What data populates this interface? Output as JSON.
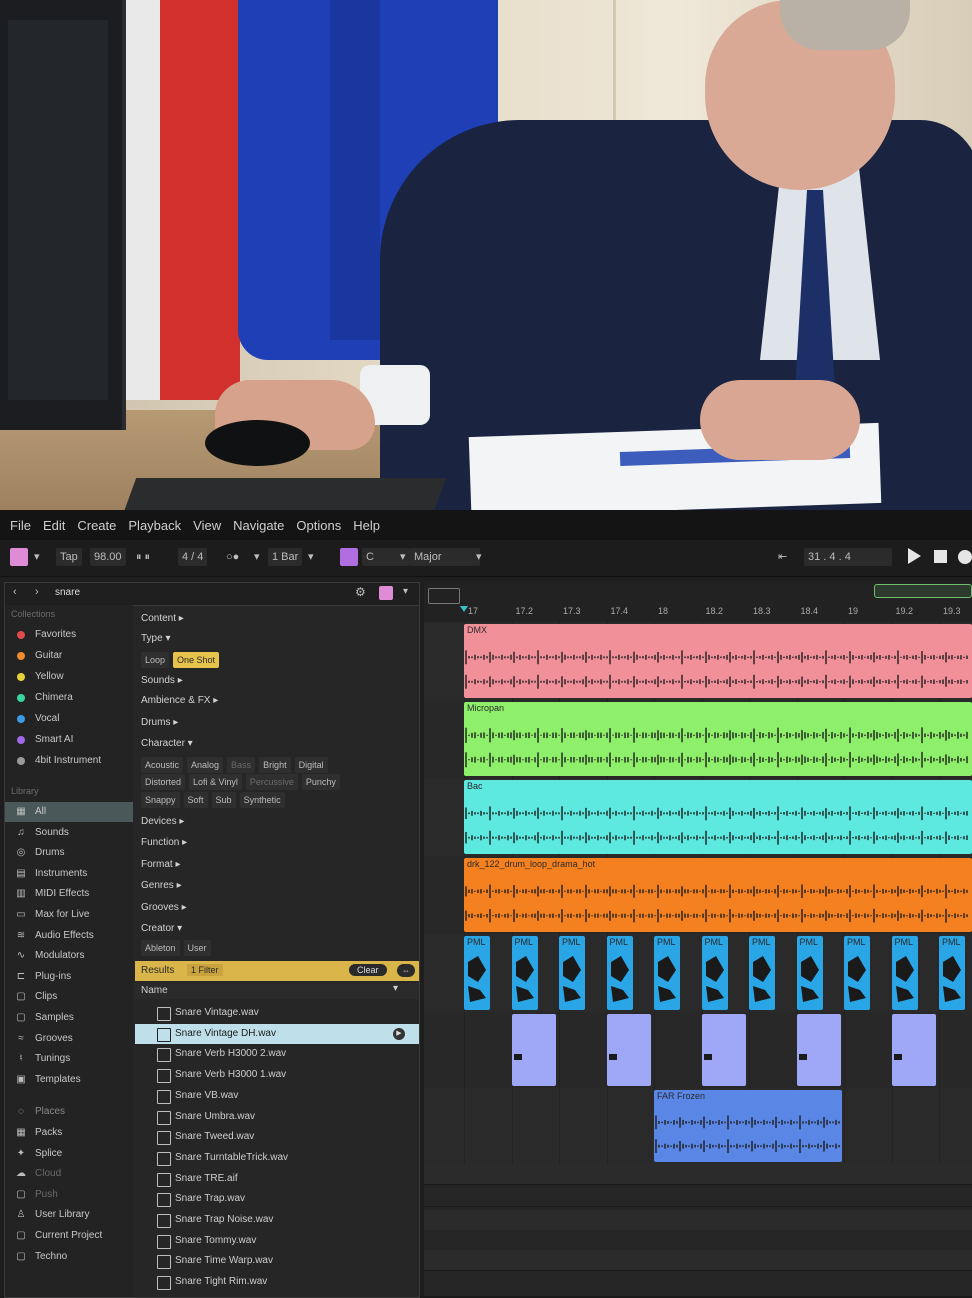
{
  "menu": [
    "File",
    "Edit",
    "Create",
    "Playback",
    "View",
    "Navigate",
    "Options",
    "Help"
  ],
  "transport": {
    "tap": "Tap",
    "tempo": "98.00",
    "time_sig": "4 / 4",
    "quant": "1 Bar",
    "key": "C",
    "scale": "Major",
    "position": "31 .  4 .  4"
  },
  "browser": {
    "search": "snare",
    "collections_head": "Collections",
    "collections": [
      {
        "label": "Favorites",
        "color": "#e04a4a"
      },
      {
        "label": "Guitar",
        "color": "#f08c2a"
      },
      {
        "label": "Yellow",
        "color": "#e6d33a"
      },
      {
        "label": "Chimera",
        "color": "#3ad6a0"
      },
      {
        "label": "Vocal",
        "color": "#3a9be6"
      },
      {
        "label": "Smart AI",
        "color": "#a06ae6"
      },
      {
        "label": "4bit Instrument",
        "color": "#9a9a9a"
      }
    ],
    "library_head": "Library",
    "library": [
      {
        "label": "All",
        "icon": "▦",
        "sel": true
      },
      {
        "label": "Sounds",
        "icon": "♫"
      },
      {
        "label": "Drums",
        "icon": "◎"
      },
      {
        "label": "Instruments",
        "icon": "▤"
      },
      {
        "label": "MIDI Effects",
        "icon": "▥"
      },
      {
        "label": "Max for Live",
        "icon": "▭"
      },
      {
        "label": "Audio Effects",
        "icon": "≋"
      },
      {
        "label": "Modulators",
        "icon": "∿"
      },
      {
        "label": "Plug-ins",
        "icon": "⊏"
      },
      {
        "label": "Clips",
        "icon": "▢"
      },
      {
        "label": "Samples",
        "icon": "▢"
      },
      {
        "label": "Grooves",
        "icon": "≈"
      },
      {
        "label": "Tunings",
        "icon": "♮"
      },
      {
        "label": "Templates",
        "icon": "▣"
      }
    ],
    "places_head": "Places",
    "places": [
      {
        "label": "Packs",
        "icon": "▦"
      },
      {
        "label": "Splice",
        "icon": "✦"
      },
      {
        "label": "Cloud",
        "icon": "☁"
      },
      {
        "label": "Push",
        "icon": "▢"
      },
      {
        "label": "User Library",
        "icon": "♙"
      },
      {
        "label": "Current Project",
        "icon": "▢"
      },
      {
        "label": "Techno",
        "icon": "▢"
      }
    ],
    "filters": {
      "content": "Content ▸",
      "type": "Type ▾",
      "type_chips": [
        {
          "label": "Loop"
        },
        {
          "label": "One Shot",
          "on": true
        }
      ],
      "sounds": "Sounds ▸",
      "ambience": "Ambience & FX ▸",
      "drums": "Drums ▸",
      "character": "Character ▾",
      "character_row1": [
        {
          "label": "Acoustic"
        },
        {
          "label": "Analog"
        },
        {
          "label": "Bass",
          "dim": true
        },
        {
          "label": "Bright"
        },
        {
          "label": "Digital"
        }
      ],
      "character_row2": [
        {
          "label": "Distorted"
        },
        {
          "label": "Lofi & Vinyl"
        },
        {
          "label": "Percussive",
          "dim": true
        },
        {
          "label": "Punchy"
        }
      ],
      "character_row3": [
        {
          "label": "Snappy"
        },
        {
          "label": "Soft"
        },
        {
          "label": "Sub"
        },
        {
          "label": "Synthetic"
        }
      ],
      "devices": "Devices ▸",
      "function": "Function ▸",
      "format": "Format ▸",
      "genres": "Genres ▸",
      "grooves": "Grooves ▸",
      "creator": "Creator ▾",
      "creator_chips": [
        {
          "label": "Ableton"
        },
        {
          "label": "User"
        }
      ]
    },
    "results_label": "Results",
    "filter_count": "1 Filter",
    "clear": "Clear",
    "name_head": "Name",
    "results": [
      "Snare Vintage.wav",
      "Snare Vintage DH.wav",
      "Snare Verb H3000 2.wav",
      "Snare Verb H3000 1.wav",
      "Snare VB.wav",
      "Snare Umbra.wav",
      "Snare Tweed.wav",
      "Snare TurntableTrick.wav",
      "Snare TRE.aif",
      "Snare Trap.wav",
      "Snare Trap Noise.wav",
      "Snare Tommy.wav",
      "Snare Time Warp.wav",
      "Snare Tight Rim.wav"
    ],
    "selected_result": 1
  },
  "arrangement": {
    "ticks": [
      "17",
      "17.2",
      "17.3",
      "17.4",
      "18",
      "18.2",
      "18.3",
      "18.4",
      "19",
      "19.2",
      "19.3"
    ],
    "tracks": [
      {
        "name": "DMX",
        "color": "#f2909a"
      },
      {
        "name": "Micropan",
        "color": "#8ef06a"
      },
      {
        "name": "Bac",
        "color": "#5de8e0"
      },
      {
        "name": "drk_122_drum_loop_drama_hot",
        "color": "#f5801f"
      },
      {
        "name": "PML",
        "color": "#2aa6e6"
      },
      {
        "name": "",
        "color": "#9fa8f7"
      },
      {
        "name": "FAR Frozen",
        "color": "#5a87e6"
      }
    ]
  }
}
